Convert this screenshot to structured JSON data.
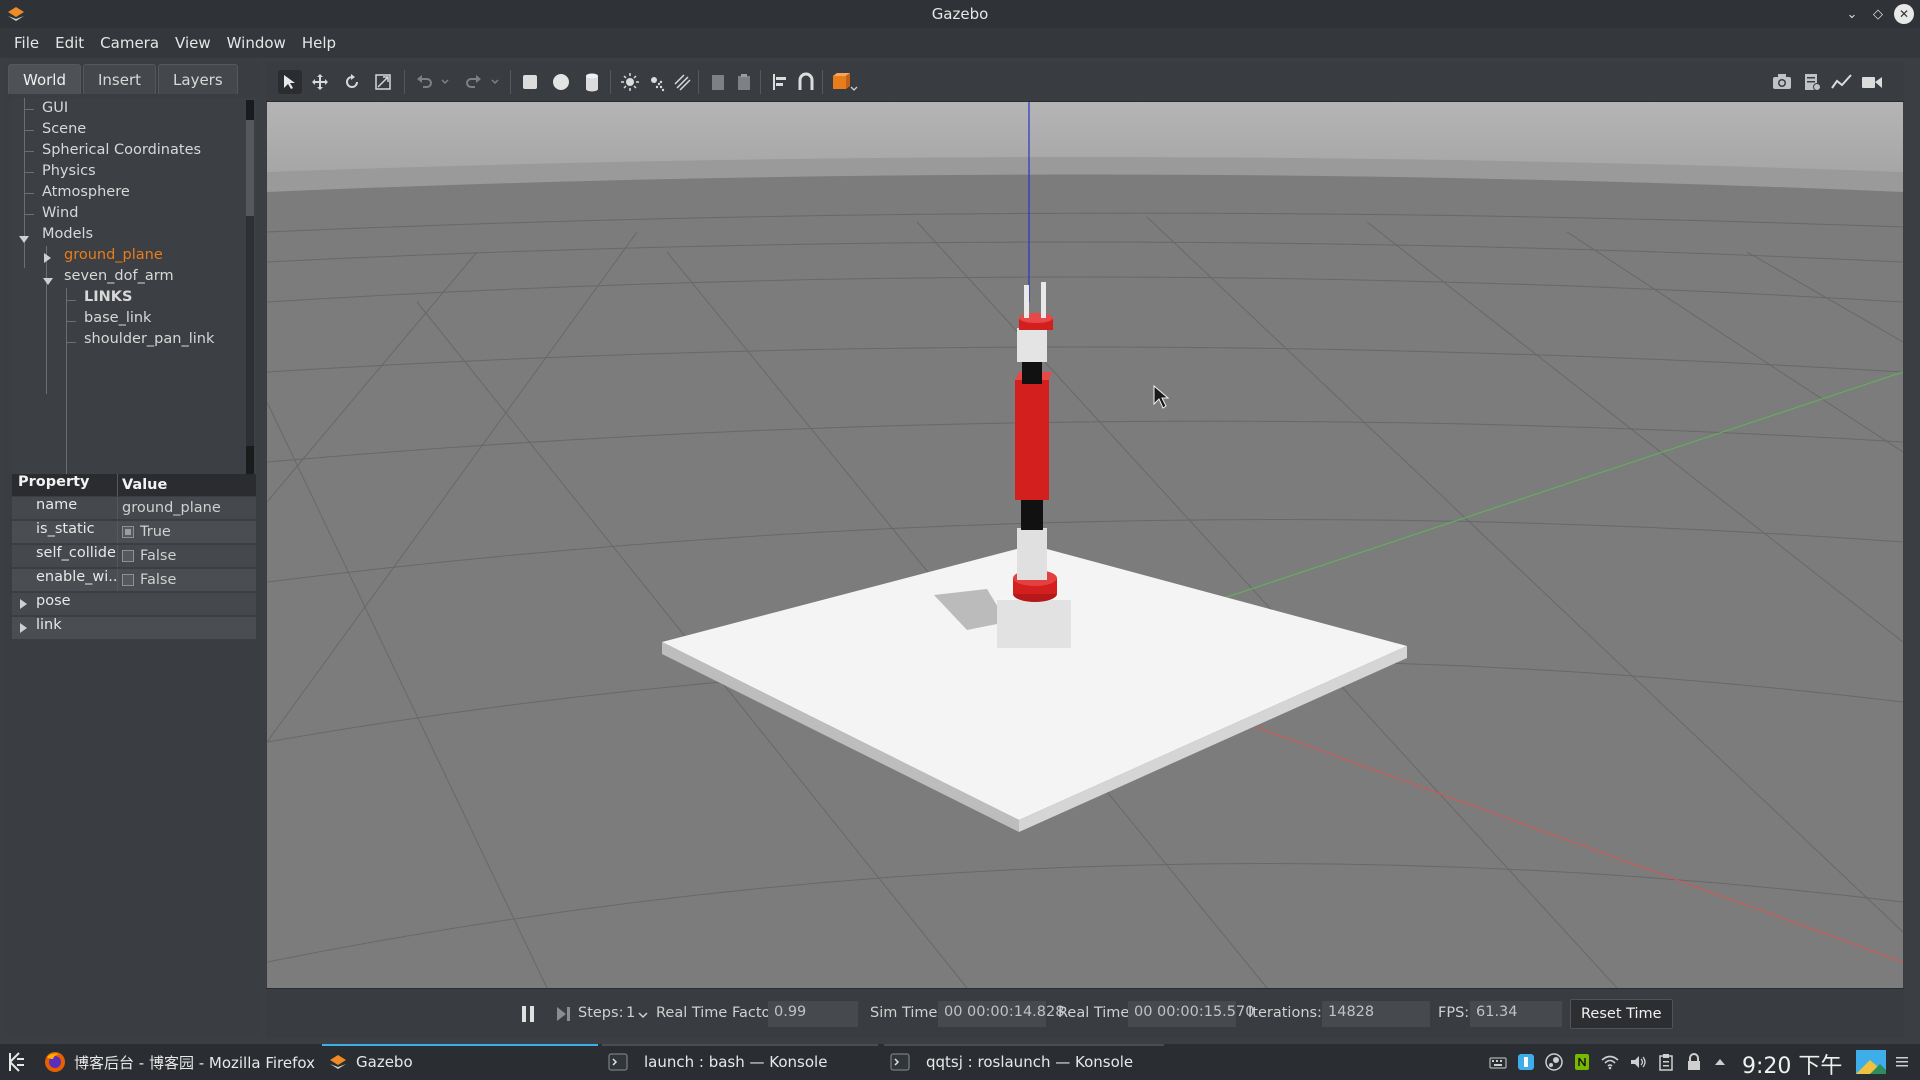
{
  "window": {
    "title": "Gazebo"
  },
  "menubar": {
    "items": [
      "File",
      "Edit",
      "Camera",
      "View",
      "Window",
      "Help"
    ]
  },
  "left_panel": {
    "tabs": [
      "World",
      "Insert",
      "Layers"
    ],
    "tree": [
      {
        "label": "GUI"
      },
      {
        "label": "Scene"
      },
      {
        "label": "Spherical Coordinates"
      },
      {
        "label": "Physics"
      },
      {
        "label": "Atmosphere"
      },
      {
        "label": "Wind"
      },
      {
        "label": "Models"
      },
      {
        "label": "ground_plane"
      },
      {
        "label": "seven_dof_arm"
      },
      {
        "label": "LINKS"
      },
      {
        "label": "base_link"
      },
      {
        "label": "shoulder_pan_link"
      }
    ],
    "properties": {
      "header_property": "Property",
      "header_value": "Value",
      "rows": [
        {
          "key": "name",
          "value": "ground_plane"
        },
        {
          "key": "is_static",
          "value": "True",
          "checked": true
        },
        {
          "key": "self_collide",
          "value": "False",
          "checked": false
        },
        {
          "key": "enable_wi...",
          "value": "False",
          "checked": false
        },
        {
          "key": "pose"
        },
        {
          "key": "link"
        }
      ]
    }
  },
  "toolbar": {
    "left_icons": [
      "select-arrow-icon",
      "translate-icon",
      "rotate-icon",
      "scale-icon",
      "undo-icon",
      "undo-dropdown-icon",
      "redo-icon",
      "redo-dropdown-icon",
      "box-icon",
      "sphere-icon",
      "cylinder-icon",
      "point-light-icon",
      "spot-light-icon",
      "directional-light-icon",
      "copy-icon",
      "paste-icon",
      "align-icon",
      "snap-icon",
      "view-angle-icon"
    ],
    "right_icons": [
      "screenshot-icon",
      "log-icon",
      "plot-icon",
      "record-video-icon"
    ]
  },
  "status": {
    "steps_label": "Steps:",
    "steps_value": "1",
    "rtf_label": "Real Time Factor:",
    "rtf_value": "0.99",
    "sim_time_label": "Sim Time:",
    "sim_time_value": "00 00:00:14.828",
    "real_time_label": "Real Time:",
    "real_time_value": "00 00:00:15.570",
    "iterations_label": "Iterations:",
    "iterations_value": "14828",
    "fps_label": "FPS:",
    "fps_value": "61.34",
    "reset_label": "Reset Time"
  },
  "taskbar": {
    "tasks": [
      {
        "label": "博客后台 - 博客园 - Mozilla Firefox"
      },
      {
        "label": "Gazebo"
      },
      {
        "label": "launch : bash — Konsole"
      },
      {
        "label": "qqtsj : roslaunch — Konsole"
      }
    ],
    "clock": "9:20 下午"
  },
  "colors": {
    "accent_orange": "#e97d1b",
    "arm_red": "#d41f1f",
    "task_active": "#3daee9"
  }
}
